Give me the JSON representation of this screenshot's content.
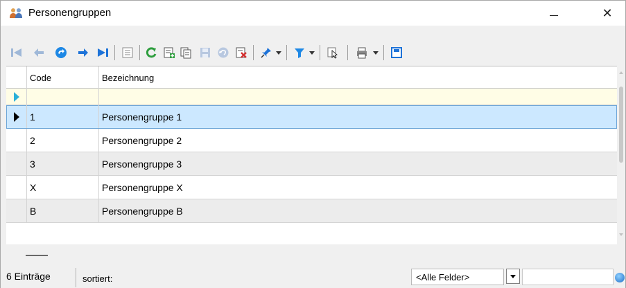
{
  "window": {
    "title": "Personengruppen",
    "icon": "people-group-icon",
    "controls": [
      "minimize-icon",
      "close-icon"
    ],
    "close_glyph": "✕"
  },
  "toolbar": {
    "buttons": [
      {
        "name": "first-record",
        "icon": "skip-to-first-icon"
      },
      {
        "name": "previous-record",
        "icon": "arrow-left-icon"
      },
      {
        "name": "goto-record",
        "icon": "goto-arrow-icon"
      },
      {
        "name": "next-record",
        "icon": "arrow-right-icon"
      },
      {
        "name": "last-record",
        "icon": "skip-to-last-icon"
      },
      {
        "name": "form-view",
        "icon": "form-view-icon"
      },
      {
        "name": "refresh",
        "icon": "refresh-icon"
      },
      {
        "name": "new-record",
        "icon": "add-record-icon"
      },
      {
        "name": "copy-record",
        "icon": "copy-record-icon"
      },
      {
        "name": "save-record",
        "icon": "save-icon"
      },
      {
        "name": "undo",
        "icon": "undo-icon"
      },
      {
        "name": "delete-record",
        "icon": "delete-record-icon"
      },
      {
        "name": "pin",
        "icon": "pin-icon"
      },
      {
        "name": "filter",
        "icon": "filter-icon"
      },
      {
        "name": "select",
        "icon": "cursor-select-icon"
      },
      {
        "name": "print",
        "icon": "print-icon"
      },
      {
        "name": "layout-save",
        "icon": "layout-save-icon"
      }
    ]
  },
  "grid": {
    "columns": [
      "Code",
      "Bezeichnung"
    ],
    "rows": [
      {
        "code": "1",
        "bezeichnung": "Personengruppe 1"
      },
      {
        "code": "2",
        "bezeichnung": "Personengruppe 2"
      },
      {
        "code": "3",
        "bezeichnung": "Personengruppe 3"
      },
      {
        "code": "X",
        "bezeichnung": "Personengruppe X"
      },
      {
        "code": "B",
        "bezeichnung": "Personengruppe B"
      }
    ]
  },
  "status": {
    "count": "6 Einträge",
    "sort_label": "sortiert:",
    "field_filter": "<Alle Felder>"
  },
  "colors": {
    "selected_row": "#cce8ff",
    "new_row": "#fffde6",
    "alt_row": "#ececec",
    "accent_arrow": "#2bb0d8"
  }
}
